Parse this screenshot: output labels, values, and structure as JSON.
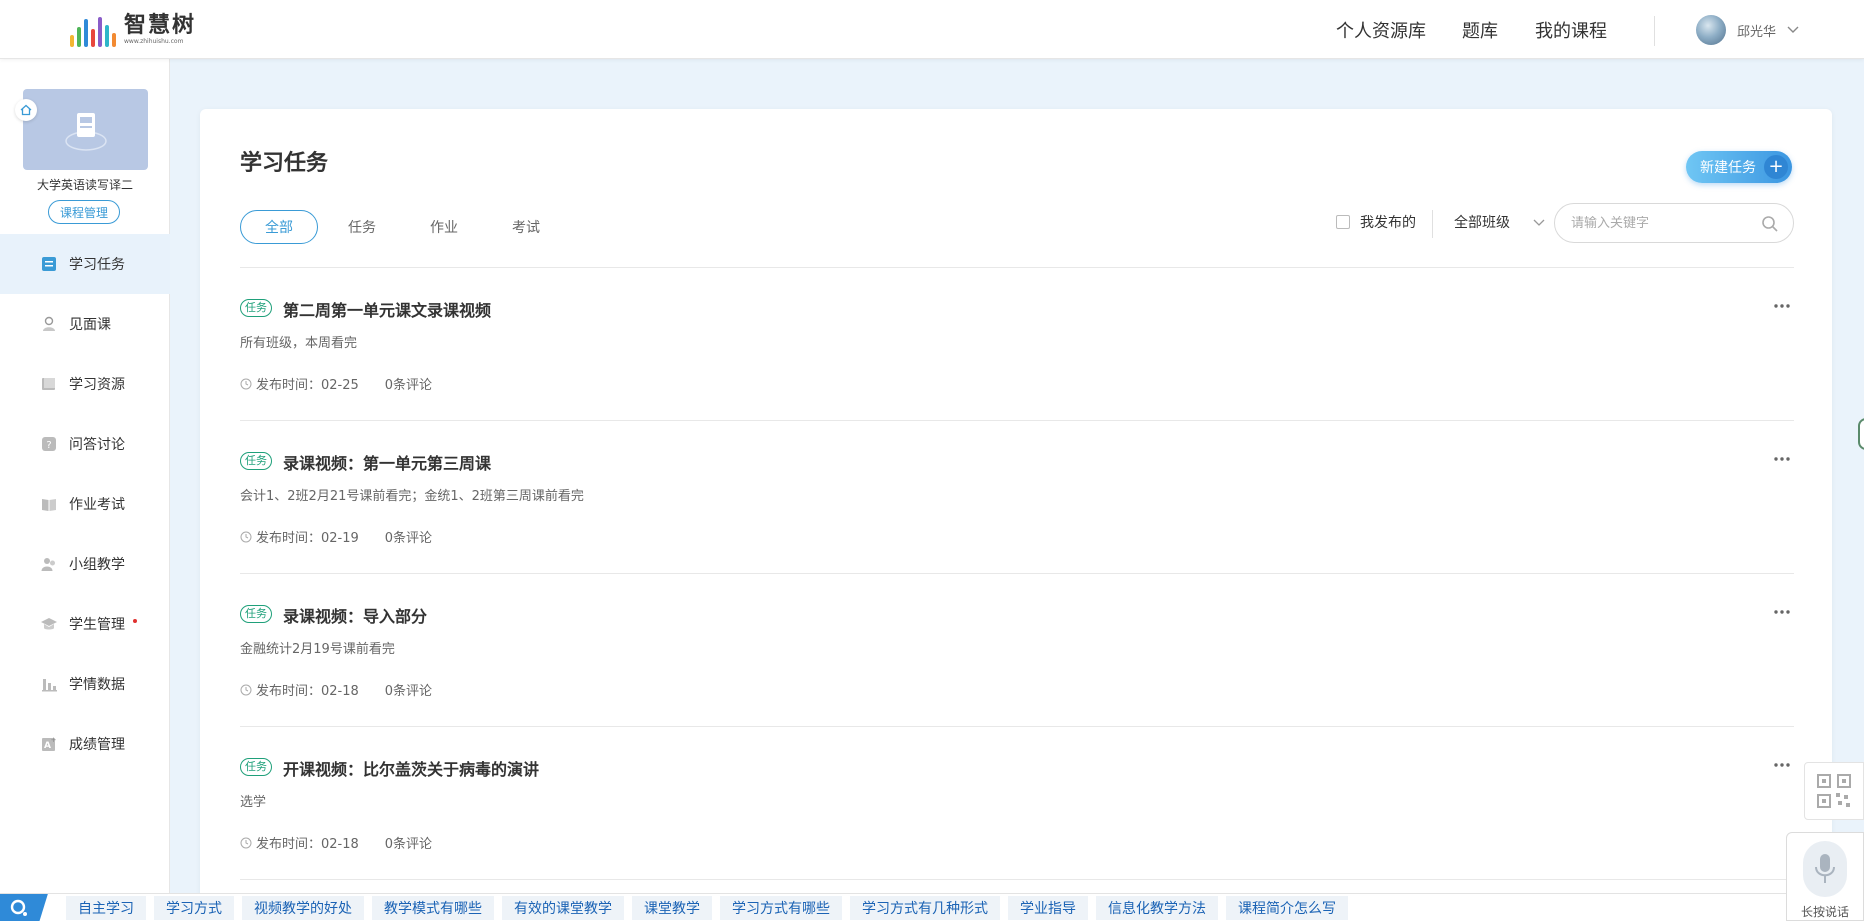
{
  "header": {
    "logo_text": "智慧树",
    "logo_sub": "www.zhihuishu.com",
    "nav": [
      "个人资源库",
      "题库",
      "我的课程"
    ],
    "username": "邱光华"
  },
  "sidebar": {
    "course_name": "大学英语读写译二",
    "course_manage": "课程管理",
    "items": [
      {
        "label": "学习任务",
        "icon": "task-list-icon"
      },
      {
        "label": "见面课",
        "icon": "person-icon"
      },
      {
        "label": "学习资源",
        "icon": "book-stack-icon"
      },
      {
        "label": "问答讨论",
        "icon": "question-icon"
      },
      {
        "label": "作业考试",
        "icon": "open-book-icon"
      },
      {
        "label": "小组教学",
        "icon": "group-icon"
      },
      {
        "label": "学生管理",
        "icon": "graduation-cap-icon"
      },
      {
        "label": "学情数据",
        "icon": "bar-chart-icon"
      },
      {
        "label": "成绩管理",
        "icon": "grade-icon"
      }
    ]
  },
  "main": {
    "title": "学习任务",
    "new_task": "新建任务",
    "tabs": [
      "全部",
      "任务",
      "作业",
      "考试"
    ],
    "filter_mine": "我发布的",
    "class_select": "全部班级",
    "search_placeholder": "请输入关键字",
    "tasks": [
      {
        "tag": "任务",
        "title": "第二周第一单元课文录课视频",
        "desc": "所有班级，本周看完",
        "publish": "发布时间：02-25",
        "comments": "0条评论"
      },
      {
        "tag": "任务",
        "title": "录课视频：第一单元第三周课",
        "desc": "会计1、2班2月21号课前看完；金统1、2班第三周课前看完",
        "publish": "发布时间：02-19",
        "comments": "0条评论"
      },
      {
        "tag": "任务",
        "title": "录课视频：导入部分",
        "desc": "金融统计2月19号课前看完",
        "publish": "发布时间：02-18",
        "comments": "0条评论"
      },
      {
        "tag": "任务",
        "title": "开课视频：比尔盖茨关于病毒的演讲",
        "desc": "选学",
        "publish": "发布时间：02-18",
        "comments": "0条评论"
      }
    ]
  },
  "widgets": {
    "voice_label": "长按说话"
  },
  "bottom_bar": {
    "keywords": [
      "自主学习",
      "学习方式",
      "视频教学的好处",
      "教学模式有哪些",
      "有效的课堂教学",
      "课堂教学",
      "学习方式有哪些",
      "学习方式有几种形式",
      "学业指导",
      "信息化教学方法",
      "课程简介怎么写"
    ]
  },
  "colors": {
    "accent": "#3a9bd6",
    "tag_green": "#1fa07a",
    "page_bg": "#eaf3fb"
  }
}
